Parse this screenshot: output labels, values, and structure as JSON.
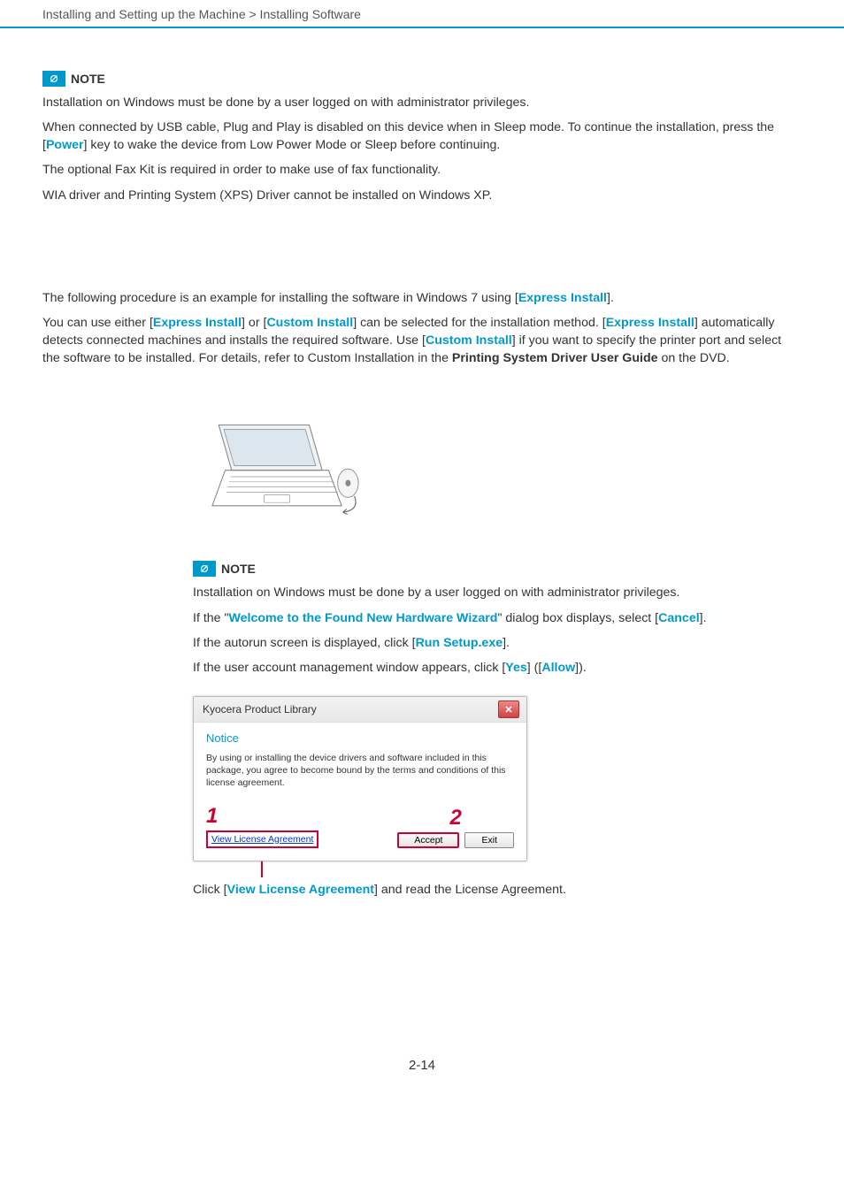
{
  "breadcrumb": "Installing and Setting up the Machine > Installing Software",
  "note1": {
    "title": "NOTE",
    "p1": "Installation on Windows must be done by a user logged on with administrator privileges.",
    "p2a": "When connected by USB cable, Plug and Play is disabled on this device when in Sleep mode. To continue the installation, press the [",
    "p2b": "Power",
    "p2c": "] key to wake the device from Low Power Mode or Sleep before continuing.",
    "p3": "The optional Fax Kit is required in order to make use of fax functionality.",
    "p4": "WIA driver and Printing System (XPS) Driver cannot be installed on Windows XP."
  },
  "main1": {
    "a": "The following procedure is an example for installing the software in Windows 7 using [",
    "b": "Express Install",
    "c": "]."
  },
  "main2": {
    "a": "You can use either [",
    "b": "Express Install",
    "c": "] or [",
    "d": "Custom Install",
    "e": "] can be selected for the installation method. [",
    "f": "Express Install",
    "g": "] automatically detects connected machines and installs the required software. Use [",
    "h": "Custom Install",
    "i": "] if you want to specify the printer port and select the software to be installed. For details, refer to Custom Installation in the ",
    "j": "Printing System Driver User Guide",
    "k": " on the DVD."
  },
  "note2": {
    "title": "NOTE",
    "p1": "Installation on Windows must be done by a user logged on with administrator privileges.",
    "p2a": "If the \"",
    "p2b": "Welcome to the Found New Hardware Wizard",
    "p2c": "\" dialog box displays, select [",
    "p2d": "Cancel",
    "p2e": "].",
    "p3a": "If the autorun screen is displayed, click [",
    "p3b": "Run Setup.exe",
    "p3c": "].",
    "p4a": "If the user account management window appears, click [",
    "p4b": "Yes",
    "p4c": "] ([",
    "p4d": "Allow",
    "p4e": "])."
  },
  "dialog": {
    "title": "Kyocera Product Library",
    "notice": "Notice",
    "text": "By using or installing the device drivers and software included in this package, you agree to become bound by the terms and conditions of this license agreement.",
    "num1": "1",
    "num2": "2",
    "viewLic": "View License Agreement",
    "accept": "Accept",
    "exit": "Exit"
  },
  "clickLine": {
    "a": "Click [",
    "b": "View License Agreement",
    "c": "] and read the License Agreement."
  },
  "pageNum": "2-14"
}
